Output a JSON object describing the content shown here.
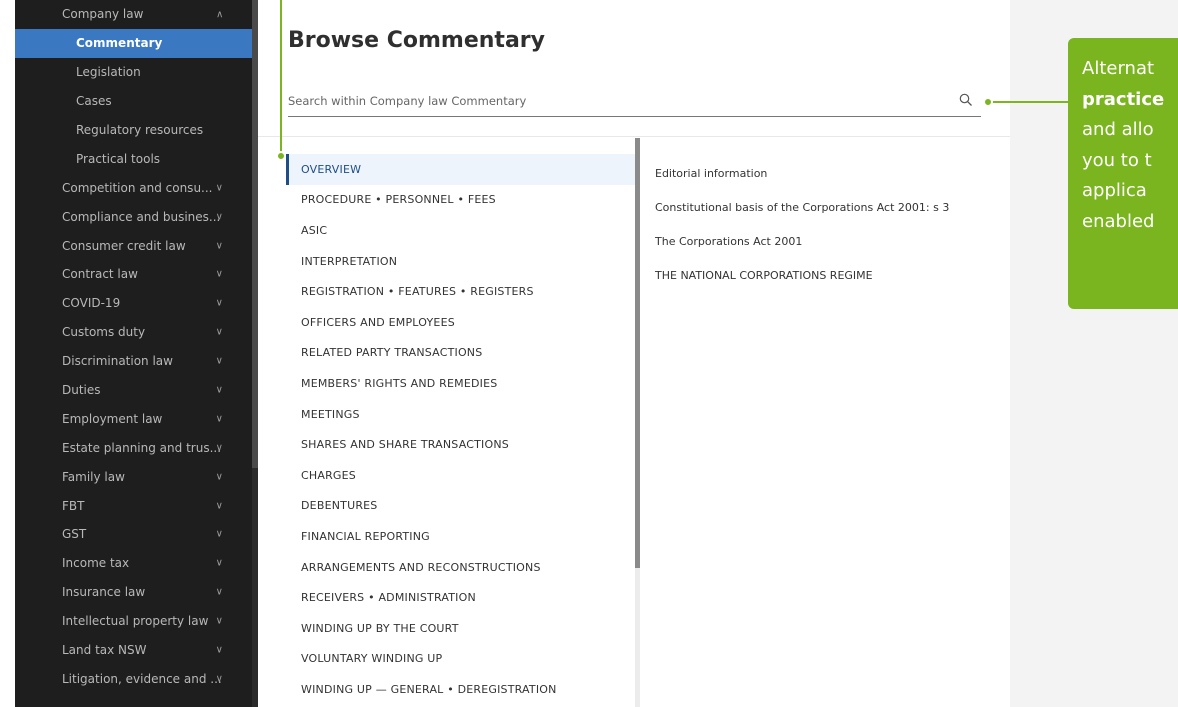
{
  "sidebar": {
    "items": [
      {
        "label": "Company law",
        "type": "top",
        "expanded": true
      },
      {
        "label": "Commentary",
        "type": "sub",
        "active": true
      },
      {
        "label": "Legislation",
        "type": "sub"
      },
      {
        "label": "Cases",
        "type": "sub"
      },
      {
        "label": "Regulatory resources",
        "type": "sub"
      },
      {
        "label": "Practical tools",
        "type": "sub"
      },
      {
        "label": "Competition and consu...",
        "type": "top"
      },
      {
        "label": "Compliance and busines...",
        "type": "top"
      },
      {
        "label": "Consumer credit law",
        "type": "top"
      },
      {
        "label": "Contract law",
        "type": "top"
      },
      {
        "label": "COVID-19",
        "type": "top"
      },
      {
        "label": "Customs duty",
        "type": "top"
      },
      {
        "label": "Discrimination law",
        "type": "top"
      },
      {
        "label": "Duties",
        "type": "top"
      },
      {
        "label": "Employment law",
        "type": "top"
      },
      {
        "label": "Estate planning and trus...",
        "type": "top"
      },
      {
        "label": "Family law",
        "type": "top"
      },
      {
        "label": "FBT",
        "type": "top"
      },
      {
        "label": "GST",
        "type": "top"
      },
      {
        "label": "Income tax",
        "type": "top"
      },
      {
        "label": "Insurance law",
        "type": "top"
      },
      {
        "label": "Intellectual property law",
        "type": "top"
      },
      {
        "label": "Land tax NSW",
        "type": "top"
      },
      {
        "label": "Litigation, evidence and ...",
        "type": "top"
      }
    ]
  },
  "main": {
    "title": "Browse Commentary",
    "search_placeholder": "Search within Company law Commentary"
  },
  "toc": {
    "items": [
      "OVERVIEW",
      "PROCEDURE • PERSONNEL • FEES",
      "ASIC",
      "INTERPRETATION",
      "REGISTRATION • FEATURES • REGISTERS",
      "OFFICERS AND EMPLOYEES",
      "RELATED PARTY TRANSACTIONS",
      "MEMBERS' RIGHTS AND REMEDIES",
      "MEETINGS",
      "SHARES AND SHARE TRANSACTIONS",
      "CHARGES",
      "DEBENTURES",
      "FINANCIAL REPORTING",
      "ARRANGEMENTS AND RECONSTRUCTIONS",
      "RECEIVERS • ADMINISTRATION",
      "WINDING UP BY THE COURT",
      "VOLUNTARY WINDING UP",
      "WINDING UP — GENERAL • DEREGISTRATION"
    ]
  },
  "detail": {
    "items": [
      "Editorial information",
      "Constitutional basis of the Corporations Act 2001: s 3",
      "The Corporations Act 2001",
      "THE NATIONAL CORPORATIONS REGIME"
    ]
  },
  "callout": {
    "lines": [
      {
        "text": "Alternat",
        "bold": false
      },
      {
        "text": "practice",
        "bold": true
      },
      {
        "text": "and allo",
        "bold": false
      },
      {
        "text": "you to t",
        "bold": false
      },
      {
        "text": "applica",
        "bold": false
      },
      {
        "text": "enabled",
        "bold": false
      }
    ]
  },
  "colors": {
    "sidebar_bg": "#1e1e1e",
    "active_blue": "#3a78c2",
    "annotation_green": "#7ab41e",
    "toc_active": "#1f4e86"
  }
}
